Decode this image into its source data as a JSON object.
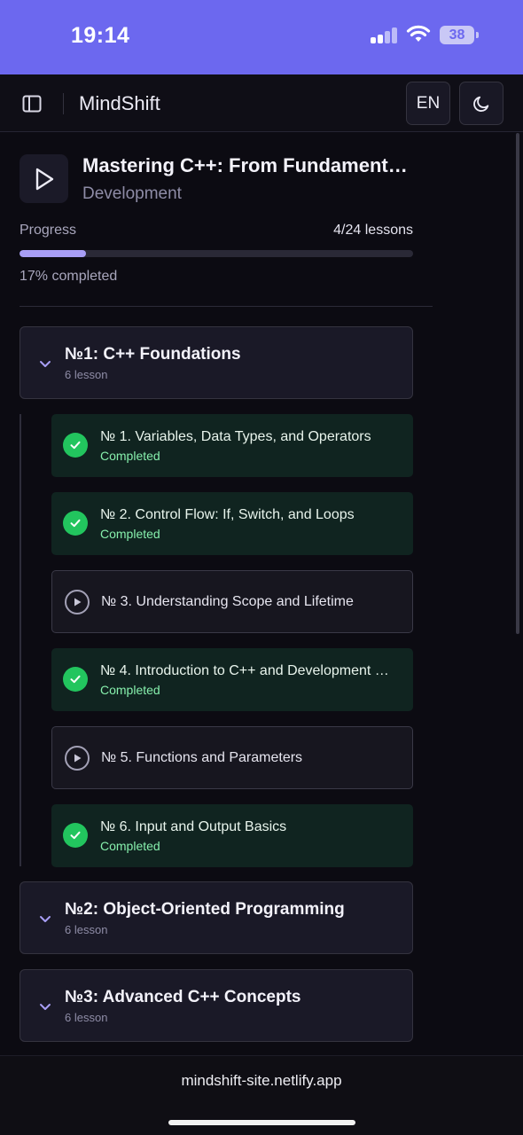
{
  "status_bar": {
    "time": "19:14",
    "battery": "38"
  },
  "header": {
    "brand": "MindShift",
    "lang_button": "EN"
  },
  "course": {
    "title": "Mastering C++: From Fundament…",
    "category": "Development",
    "progress_label": "Progress",
    "progress_count": "4/24 lessons",
    "progress_fraction": 0.17,
    "progress_percent_text": "17% completed"
  },
  "modules": [
    {
      "title": "№1: C++ Foundations",
      "count": "6 lesson",
      "lessons": [
        {
          "title": "№ 1. Variables, Data Types, and Operators",
          "status": "Completed",
          "done": true
        },
        {
          "title": "№ 2. Control Flow: If, Switch, and Loops",
          "status": "Completed",
          "done": true
        },
        {
          "title": "№ 3. Understanding Scope and Lifetime",
          "status": "",
          "done": false
        },
        {
          "title": "№ 4. Introduction to C++ and Development …",
          "status": "Completed",
          "done": true
        },
        {
          "title": "№ 5. Functions and Parameters",
          "status": "",
          "done": false
        },
        {
          "title": "№ 6. Input and Output Basics",
          "status": "Completed",
          "done": true
        }
      ]
    },
    {
      "title": "№2: Object-Oriented Programming",
      "count": "6 lesson"
    },
    {
      "title": "№3: Advanced C++ Concepts",
      "count": "6 lesson"
    }
  ],
  "browser": {
    "url": "mindshift-site.netlify.app"
  },
  "colors": {
    "accent": "#6c68ef",
    "progress": "#a89ef5",
    "completed": "#22c55e"
  },
  "icons": [
    "sidebar-toggle-icon",
    "moon-icon",
    "play-icon",
    "chevron-down-icon",
    "check-icon",
    "play-circle-icon"
  ]
}
